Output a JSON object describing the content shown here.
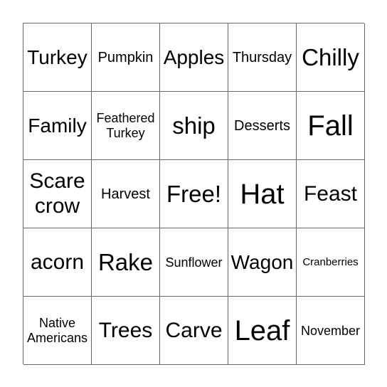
{
  "board": {
    "cells": [
      {
        "text": "Turkey",
        "size": "s-ml"
      },
      {
        "text": "Pumpkin",
        "size": "s-sm"
      },
      {
        "text": "Apples",
        "size": "s-ml"
      },
      {
        "text": "Thursday",
        "size": "s-sm"
      },
      {
        "text": "Chilly",
        "size": "s-l"
      },
      {
        "text": "Family",
        "size": "s-ml"
      },
      {
        "text": "Feathered\nTurkey",
        "size": "s-s",
        "multiline": true
      },
      {
        "text": "ship",
        "size": "s-l"
      },
      {
        "text": "Desserts",
        "size": "s-sm"
      },
      {
        "text": "Fall",
        "size": "s-xl"
      },
      {
        "text": "Scare\ncrow",
        "size": "s-m",
        "multiline": true
      },
      {
        "text": "Harvest",
        "size": "s-sm"
      },
      {
        "text": "Free!",
        "size": "s-l"
      },
      {
        "text": "Hat",
        "size": "s-xl"
      },
      {
        "text": "Feast",
        "size": "s-m"
      },
      {
        "text": "acorn",
        "size": "s-m"
      },
      {
        "text": "Rake",
        "size": "s-l"
      },
      {
        "text": "Sunflower",
        "size": "s-s"
      },
      {
        "text": "Wagon",
        "size": "s-ml"
      },
      {
        "text": "Cranberries",
        "size": "s-xs"
      },
      {
        "text": "Native\nAmericans",
        "size": "s-s",
        "multiline": true
      },
      {
        "text": "Trees",
        "size": "s-m"
      },
      {
        "text": "Carve",
        "size": "s-m"
      },
      {
        "text": "Leaf",
        "size": "s-xl"
      },
      {
        "text": "November",
        "size": "s-s"
      }
    ]
  }
}
